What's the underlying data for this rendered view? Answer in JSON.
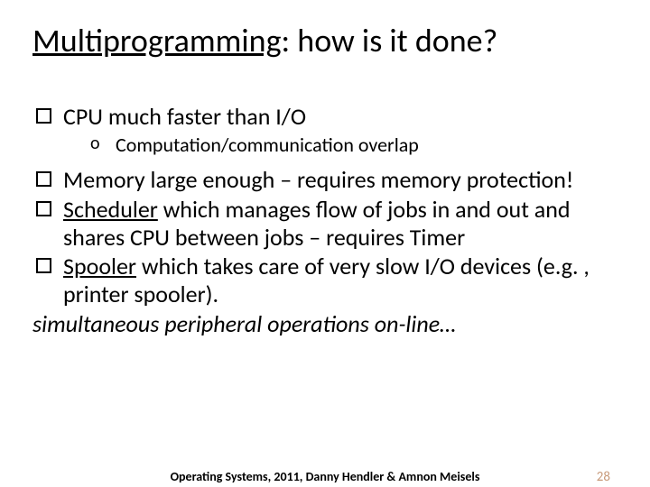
{
  "title": {
    "underlined": "Multiprogramming",
    "rest": ": how is it done?"
  },
  "bullets": {
    "b1": "CPU much faster than I/O",
    "b1_sub1": "Computation/communication overlap",
    "b2": "Memory large enough  – requires memory protection!",
    "b3_u": "Scheduler",
    "b3_rest": " which manages flow of jobs in and out and shares CPU between jobs – requires Timer",
    "b4_u": "Spooler",
    "b4_rest": " which takes care of very slow I/O devices (e.g. , printer spooler)."
  },
  "spool_expansion": "simultaneous peripheral operations on-line…",
  "footer": {
    "source": "Operating Systems, 2011, Danny Hendler & Amnon Meisels",
    "page": "28"
  }
}
